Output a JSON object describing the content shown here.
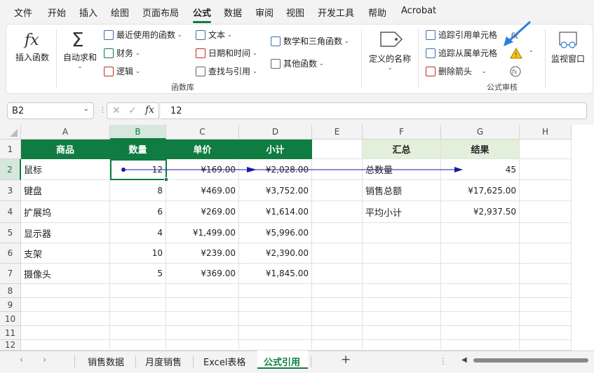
{
  "menu": [
    "文件",
    "开始",
    "插入",
    "绘图",
    "页面布局",
    "公式",
    "数据",
    "审阅",
    "视图",
    "开发工具",
    "帮助",
    "Acrobat"
  ],
  "ribbon": {
    "insert_function": "插入函数",
    "autosum": "自动求和",
    "recent": "最近使用的函数",
    "financial": "财务",
    "logical": "逻辑",
    "text": "文本",
    "datetime": "日期和时间",
    "lookup": "查找与引用",
    "math": "数学和三角函数",
    "other": "其他函数",
    "function_library": "函数库",
    "define_name": "定义的名称",
    "trace_precedents": "追踪引用单元格",
    "trace_dependents": "追踪从属单元格",
    "remove_arrows": "删除箭头",
    "formula_auditing": "公式审核",
    "watch_window": "监视窗口"
  },
  "formula_bar": {
    "name_box": "B2",
    "formula": "12"
  },
  "columns": [
    "A",
    "B",
    "C",
    "D",
    "E",
    "F",
    "G",
    "H"
  ],
  "rows": [
    "1",
    "2",
    "3",
    "4",
    "5",
    "6",
    "7",
    "8",
    "9",
    "10",
    "11",
    "12"
  ],
  "table": {
    "headers": [
      "商品",
      "数量",
      "单价",
      "小计"
    ],
    "rows": [
      [
        "鼠标",
        "12",
        "¥169.00",
        "¥2,028.00"
      ],
      [
        "键盘",
        "8",
        "¥469.00",
        "¥3,752.00"
      ],
      [
        "扩展坞",
        "6",
        "¥269.00",
        "¥1,614.00"
      ],
      [
        "显示器",
        "4",
        "¥1,499.00",
        "¥5,996.00"
      ],
      [
        "支架",
        "10",
        "¥239.00",
        "¥2,390.00"
      ],
      [
        "摄像头",
        "5",
        "¥369.00",
        "¥1,845.00"
      ]
    ]
  },
  "summary": {
    "headers": [
      "汇总",
      "结果"
    ],
    "rows": [
      [
        "总数量",
        "45"
      ],
      [
        "销售总额",
        "¥17,625.00"
      ],
      [
        "平均小计",
        "¥2,937.50"
      ]
    ]
  },
  "sheets": [
    "销售数据",
    "月度销售",
    "Excel表格",
    "公式引用"
  ],
  "colors": {
    "accent": "#107c41",
    "trace_arrow": "#1a1aa6",
    "header_fill": "#107c41",
    "summary_fill": "#e2efda"
  }
}
